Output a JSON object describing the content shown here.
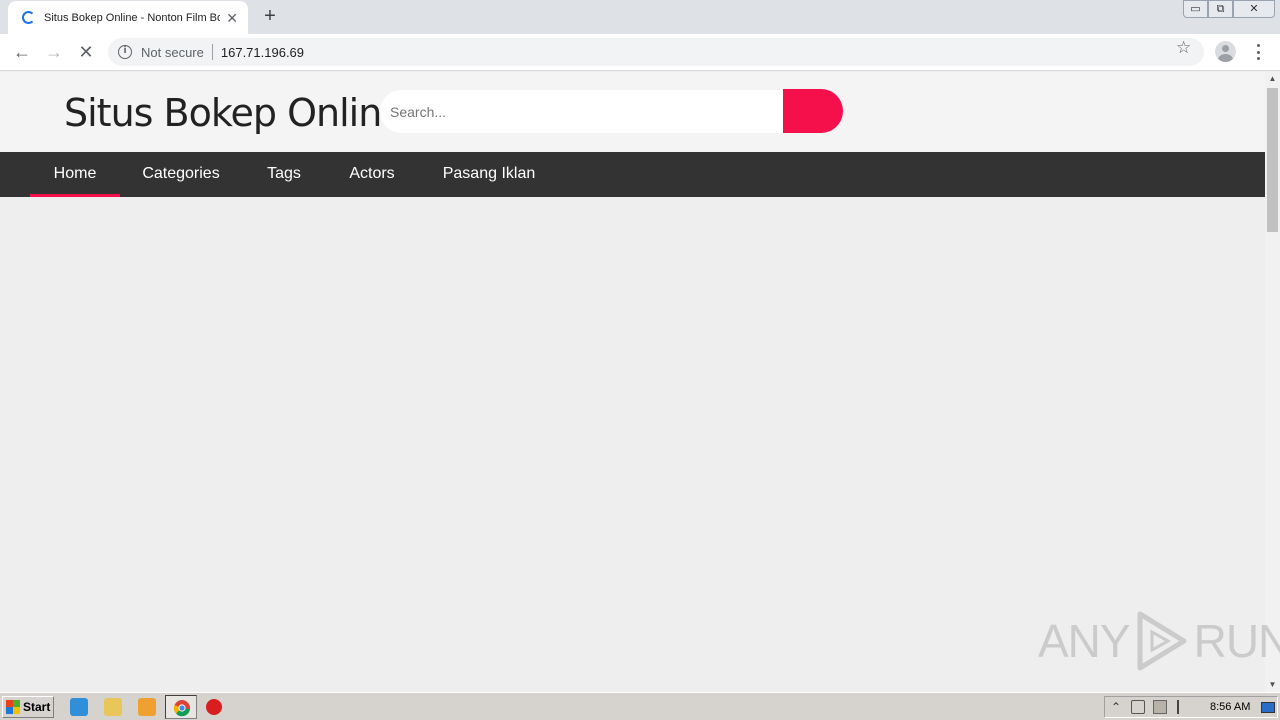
{
  "browser": {
    "tab": {
      "title": "Situs Bokep Online - Nonton Film Bokep",
      "close": "✕"
    },
    "new_tab": "+",
    "window_controls": {
      "minimize": "▭",
      "maximize": "⧉",
      "close": "✕"
    },
    "nav": {
      "back": "←",
      "forward": "→",
      "stop": "✕"
    },
    "omnibox": {
      "info_icon": "i",
      "security_label": "Not secure",
      "url": "167.71.196.69"
    },
    "star": "☆"
  },
  "site": {
    "logo": "Situs Bokep Online",
    "search": {
      "placeholder": "Search..."
    },
    "nav": [
      {
        "label": "Home",
        "active": true
      },
      {
        "label": "Categories"
      },
      {
        "label": "Tags"
      },
      {
        "label": "Actors"
      },
      {
        "label": "Pasang Iklan"
      }
    ],
    "accent_color": "#f5104c",
    "nav_background": "#333333"
  },
  "scrollbar": {
    "up": "▲",
    "down": "▼"
  },
  "watermark": {
    "left": "ANY",
    "right": "RUN"
  },
  "taskbar": {
    "start_label": "Start",
    "apps": [
      "internet-explorer-icon",
      "folder-icon",
      "media-player-icon",
      "chrome-icon",
      "stop-sign-icon"
    ],
    "tray": {
      "expand": "⌃",
      "clock": "8:56 AM"
    }
  }
}
